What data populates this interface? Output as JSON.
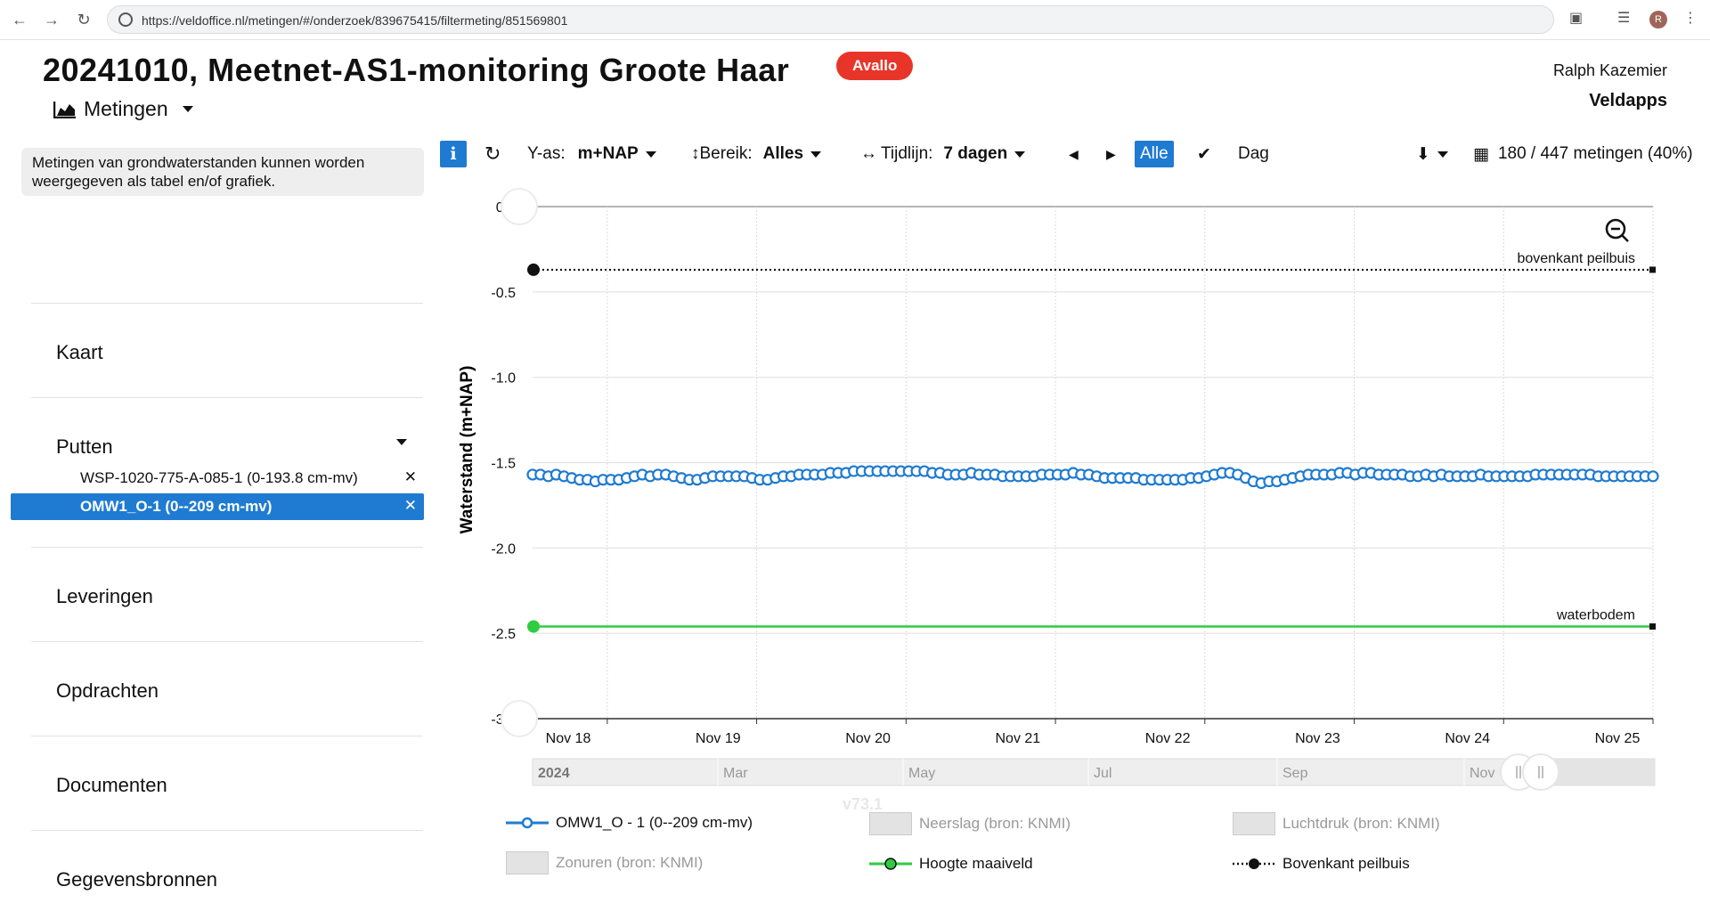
{
  "browser": {
    "url": "https://veldoffice.nl/metingen/#/onderzoek/839675415/filtermeting/851569801",
    "profile_initial": "R"
  },
  "header": {
    "title": "20241010, Meetnet-AS1-monitoring Groote Haar",
    "badge": "Avallo",
    "user": "Ralph Kazemier",
    "org": "Veldapps",
    "menu_label": "Metingen"
  },
  "sidebar": {
    "info": "Metingen van grondwaterstanden kunnen worden weergegeven als tabel en/of grafiek.",
    "sections": {
      "kaart": "Kaart",
      "putten": "Putten",
      "leveringen": "Leveringen",
      "opdrachten": "Opdrachten",
      "documenten": "Documenten",
      "gegevensbronnen": "Gegevensbronnen"
    },
    "wells": [
      {
        "label": "WSP-1020-775-A-085-1 (0-193.8 cm-mv)",
        "active": false
      },
      {
        "label": "OMW1_O-1 (0--209 cm-mv)",
        "active": true
      }
    ]
  },
  "toolbar": {
    "info_icon": "i",
    "yaxis_label": "Y-as:",
    "yaxis_value": "m+NAP",
    "bereik_label": "Bereik:",
    "bereik_value": "Alles",
    "tijdlijn_label": "Tijdlijn:",
    "tijdlijn_value": "7 dagen",
    "alle_label": "Alle",
    "dag_label": "Dag",
    "count": "180 / 447 metingen (40%)"
  },
  "chart_data": {
    "type": "line",
    "ylabel": "Waterstand (m+NAP)",
    "ylim": [
      -3.0,
      0.0
    ],
    "yticks": [
      "0.0",
      "-0.5",
      "-1.0",
      "-1.5",
      "-2.0",
      "-2.5",
      "-3.0"
    ],
    "x_categories": [
      "Nov 18",
      "Nov 19",
      "Nov 20",
      "Nov 21",
      "Nov 22",
      "Nov 23",
      "Nov 24",
      "Nov 25"
    ],
    "navigator_labels": [
      "2024",
      "Mar",
      "May",
      "Jul",
      "Sep",
      "Nov"
    ],
    "reference_lines": [
      {
        "name": "Bovenkant peilbuis",
        "label": "bovenkant peilbuis",
        "value": -0.37,
        "color": "#111111"
      },
      {
        "name": "Hoogte maaiveld",
        "label": "waterbodem",
        "value": -2.46,
        "color": "#2ecc40"
      }
    ],
    "series": [
      {
        "name": "OMW1_O - 1 (0--209 cm-mv)",
        "color": "#1f7bd1",
        "x_range_days": [
          0,
          7.5
        ],
        "values": [
          -1.57,
          -1.57,
          -1.58,
          -1.57,
          -1.58,
          -1.59,
          -1.6,
          -1.6,
          -1.61,
          -1.6,
          -1.6,
          -1.6,
          -1.59,
          -1.58,
          -1.57,
          -1.58,
          -1.57,
          -1.57,
          -1.58,
          -1.59,
          -1.6,
          -1.6,
          -1.59,
          -1.58,
          -1.58,
          -1.58,
          -1.58,
          -1.58,
          -1.59,
          -1.6,
          -1.6,
          -1.59,
          -1.58,
          -1.58,
          -1.57,
          -1.57,
          -1.57,
          -1.57,
          -1.56,
          -1.56,
          -1.56,
          -1.55,
          -1.55,
          -1.55,
          -1.55,
          -1.55,
          -1.55,
          -1.55,
          -1.55,
          -1.55,
          -1.55,
          -1.56,
          -1.56,
          -1.57,
          -1.57,
          -1.57,
          -1.56,
          -1.57,
          -1.57,
          -1.57,
          -1.58,
          -1.58,
          -1.58,
          -1.58,
          -1.58,
          -1.57,
          -1.57,
          -1.57,
          -1.57,
          -1.56,
          -1.57,
          -1.57,
          -1.58,
          -1.59,
          -1.59,
          -1.59,
          -1.59,
          -1.59,
          -1.6,
          -1.6,
          -1.6,
          -1.6,
          -1.6,
          -1.6,
          -1.59,
          -1.59,
          -1.58,
          -1.57,
          -1.56,
          -1.56,
          -1.57,
          -1.59,
          -1.61,
          -1.62,
          -1.61,
          -1.61,
          -1.6,
          -1.59,
          -1.58,
          -1.57,
          -1.57,
          -1.57,
          -1.57,
          -1.56,
          -1.56,
          -1.57,
          -1.56,
          -1.56,
          -1.57,
          -1.57,
          -1.57,
          -1.57,
          -1.58,
          -1.58,
          -1.57,
          -1.58,
          -1.57,
          -1.58,
          -1.58,
          -1.58,
          -1.58,
          -1.57,
          -1.58,
          -1.58,
          -1.58,
          -1.58,
          -1.58,
          -1.58,
          -1.57,
          -1.57,
          -1.57,
          -1.57,
          -1.57,
          -1.57,
          -1.57,
          -1.57,
          -1.58,
          -1.58,
          -1.58,
          -1.58,
          -1.58,
          -1.58,
          -1.58,
          -1.58
        ]
      }
    ]
  },
  "legend": [
    {
      "label": "OMW1_O - 1 (0--209 cm-mv)",
      "kind": "series",
      "active": true
    },
    {
      "label": "Neerslag (bron: KNMI)",
      "kind": "box",
      "active": false
    },
    {
      "label": "Luchtdruk (bron: KNMI)",
      "kind": "box",
      "active": false
    },
    {
      "label": "Zonuren (bron: KNMI)",
      "kind": "box",
      "active": false
    },
    {
      "label": "Hoogte maaiveld",
      "kind": "green",
      "active": true
    },
    {
      "label": "Bovenkant peilbuis",
      "kind": "black",
      "active": true
    }
  ],
  "version": "v73.1"
}
